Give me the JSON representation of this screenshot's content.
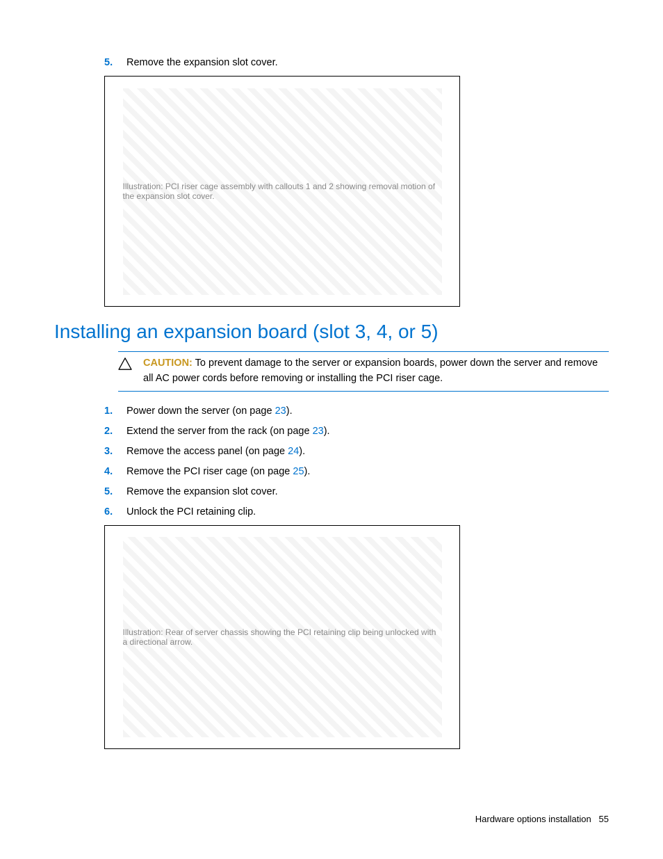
{
  "top_step": {
    "num": "5.",
    "text": "Remove the expansion slot cover."
  },
  "figure1_alt": "Illustration: PCI riser cage assembly with callouts 1 and 2 showing removal motion of the expansion slot cover.",
  "heading": "Installing an expansion board (slot 3, 4, or 5)",
  "caution": {
    "label": "CAUTION:",
    "text": " To prevent damage to the server or expansion boards, power down the server and remove all AC power cords before removing or installing the PCI riser cage."
  },
  "steps": [
    {
      "num": "1.",
      "pre": "Power down the server (on page ",
      "link": "23",
      "post": ")."
    },
    {
      "num": "2.",
      "pre": "Extend the server from the rack (on page ",
      "link": "23",
      "post": ")."
    },
    {
      "num": "3.",
      "pre": "Remove the access panel (on page ",
      "link": "24",
      "post": ")."
    },
    {
      "num": "4.",
      "pre": "Remove the PCI riser cage (on page ",
      "link": "25",
      "post": ")."
    },
    {
      "num": "5.",
      "pre": "Remove the expansion slot cover.",
      "link": "",
      "post": ""
    },
    {
      "num": "6.",
      "pre": "Unlock the PCI retaining clip.",
      "link": "",
      "post": ""
    }
  ],
  "figure2_alt": "Illustration: Rear of server chassis showing the PCI retaining clip being unlocked with a directional arrow.",
  "footer": {
    "section": "Hardware options installation",
    "page": "55"
  }
}
